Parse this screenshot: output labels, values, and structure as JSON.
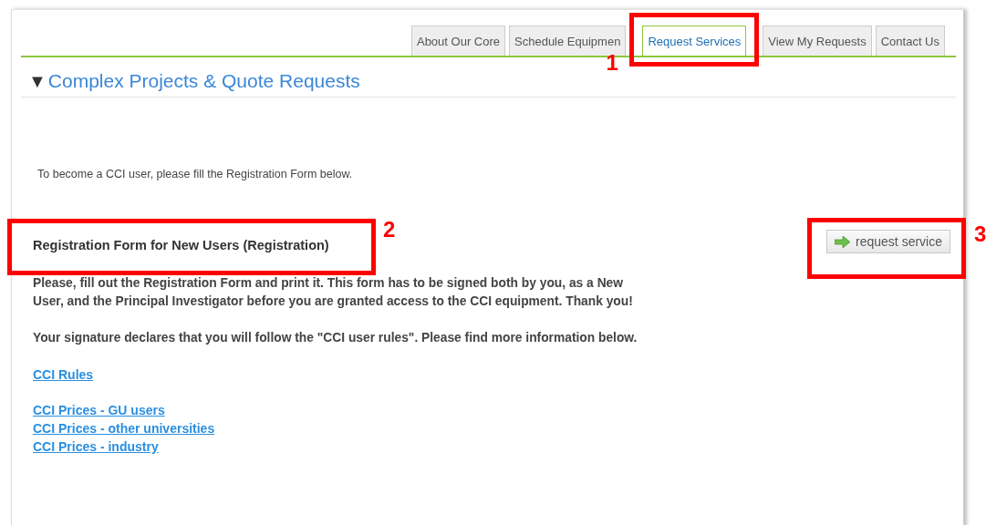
{
  "tabs": [
    {
      "label": "About Our Core",
      "selected": false
    },
    {
      "label": "Schedule Equipmen",
      "selected": false
    },
    {
      "label": "Request Services",
      "selected": true
    },
    {
      "label": "View My Requests",
      "selected": false
    },
    {
      "label": "Contact Us",
      "selected": false
    }
  ],
  "section": {
    "toggle": "▼",
    "title": "Complex Projects & Quote Requests",
    "expanded": true
  },
  "intro": "To become a CCI user, please fill the Registration Form below.",
  "form": {
    "title": "Registration Form for New Users (Registration)",
    "paragraphs": [
      "Please, fill out the Registration Form and print it. This form has to be signed both by you, as a New User, and the Principal Investigator before you are granted access to the CCI equipment. Thank you!",
      "Your signature declares that you will follow the \"CCI user rules\". Please find more information below."
    ],
    "link_groups": [
      [
        "CCI Rules"
      ],
      [
        "CCI Prices - GU users",
        "CCI Prices - other universities",
        "CCI Prices - industry"
      ]
    ],
    "button": "request service"
  },
  "annotations": [
    {
      "label": "1"
    },
    {
      "label": "2"
    },
    {
      "label": "3"
    }
  ]
}
